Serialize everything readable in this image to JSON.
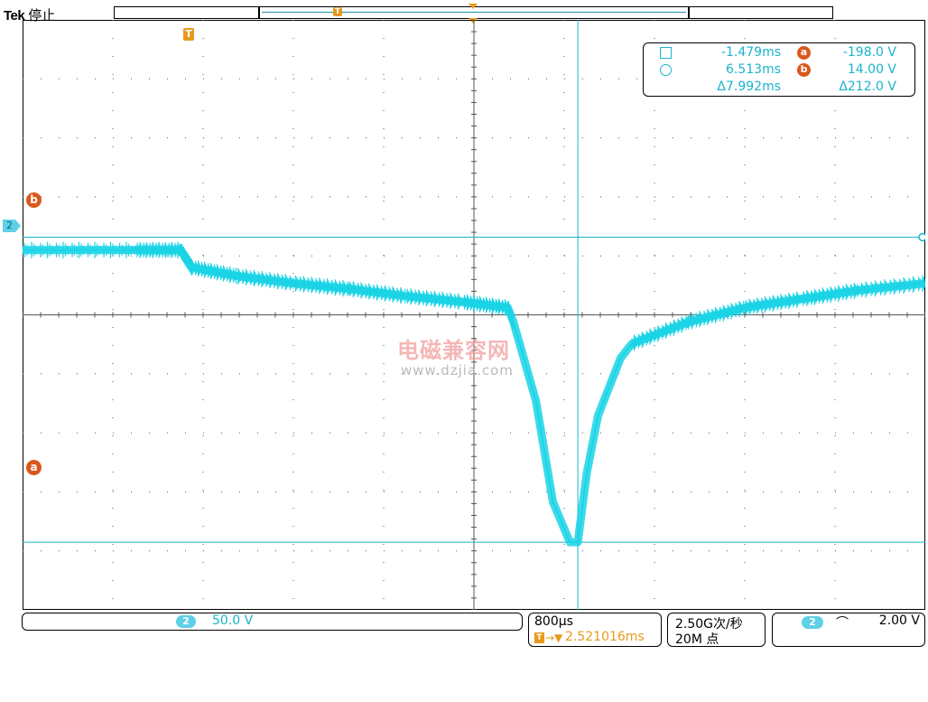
{
  "header": {
    "brand": "Tek",
    "status": "停止"
  },
  "markers": {
    "trigger_label": "T",
    "cursor_a_label": "a",
    "cursor_b_label": "b",
    "channel_label": "2"
  },
  "cursor_readout": {
    "rows": [
      {
        "symbol": "square-icon",
        "time": "-1.479ms",
        "label": "a",
        "value": "-198.0 V"
      },
      {
        "symbol": "circle-icon",
        "time": "6.513ms",
        "label": "b",
        "value": "14.00 V"
      },
      {
        "symbol": "delta",
        "time": "Δ7.992ms",
        "label": "",
        "value": "Δ212.0 V"
      }
    ]
  },
  "status_bar": {
    "channel": {
      "badge": "2",
      "scale": "50.0 V"
    },
    "timebase": {
      "scale": "800µs",
      "delay_icon": "T",
      "delay_arrow": "→▼",
      "delay": "2.521016ms"
    },
    "acquisition": {
      "rate": "2.50G次/秒",
      "length": "20M 点"
    },
    "trigger": {
      "badge": "2",
      "slope": "falling-edge-icon",
      "slope_glyph": "⌒",
      "level": "2.00 V"
    }
  },
  "watermark": {
    "cn": "电磁兼容网",
    "url": "www.dzjia.com"
  },
  "colors": {
    "trace": "#1ad4e6",
    "cursor": "#1ab4cc",
    "trigger": "#e89a1c",
    "cursor_badge": "#d9581c"
  },
  "chart_data": {
    "type": "line",
    "xlabel": "",
    "ylabel": "",
    "x_unit": "ms",
    "y_unit": "V",
    "xlim": [
      -6.4,
      1.6
    ],
    "ylim": [
      -245,
      165
    ],
    "grid": true,
    "series": [
      {
        "x": [
          -6.4,
          -5.4,
          -5.0,
          -4.9,
          -4.5,
          -4.0,
          -3.5,
          -3.0,
          -2.5,
          -2.1,
          -2.05,
          -1.85,
          -1.7,
          -1.55,
          -1.479,
          -1.4,
          -1.3,
          -1.2,
          -1.1,
          -1.0,
          -0.5,
          0.0,
          0.5,
          1.0,
          1.6
        ],
        "y": [
          5,
          5,
          5,
          -7,
          -13,
          -18,
          -22,
          -27,
          -31,
          -35,
          -45,
          -100,
          -170,
          -198,
          -198,
          -150,
          -110,
          -90,
          -70,
          -60,
          -45,
          -35,
          -29,
          -23,
          -18
        ]
      }
    ],
    "cursors": {
      "a": {
        "time_ms": -1.479,
        "voltage_v": -198.0
      },
      "b": {
        "time_ms": 6.513,
        "voltage_v": 14.0
      }
    }
  }
}
